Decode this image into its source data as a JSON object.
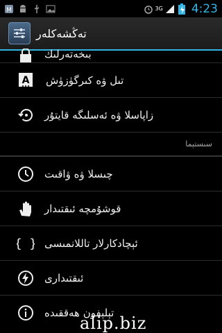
{
  "status_bar": {
    "icons": [
      "app-notification-icon",
      "android-icon",
      "usb-icon",
      "image-icon"
    ],
    "network_label": "3G",
    "time": "4:23",
    "colors": {
      "accent": "#33b5e5",
      "battery": "#33b5e5"
    }
  },
  "action_bar": {
    "title": "تەڭشەكلەر",
    "icon": "settings-sliders-icon"
  },
  "rows_top": [
    {
      "label": "بىخەتەرلىك",
      "icon": "lock-icon"
    },
    {
      "label": "تىل ۋە كىرگۈزۈش",
      "icon": "keyboard-a-icon"
    },
    {
      "label": "زاپاسلا ۋە ئەسلىگە قايتۇر",
      "icon": "backup-restore-icon"
    }
  ],
  "section": {
    "label": "سىستېما"
  },
  "rows_system": [
    {
      "label": "چىسلا ۋە ۋاقىت",
      "icon": "clock-icon"
    },
    {
      "label": "قوشۇمچە ئىقتىدار",
      "icon": "hand-icon"
    },
    {
      "label": "ئېچادكارلار تاللانمىسى",
      "icon": "braces-icon"
    },
    {
      "label": "ئىقتىدارى",
      "icon": "power-bolt-icon"
    },
    {
      "label": "تېلېفون ھەققىدە",
      "icon": "info-icon"
    }
  ],
  "watermark": "alip.biz"
}
